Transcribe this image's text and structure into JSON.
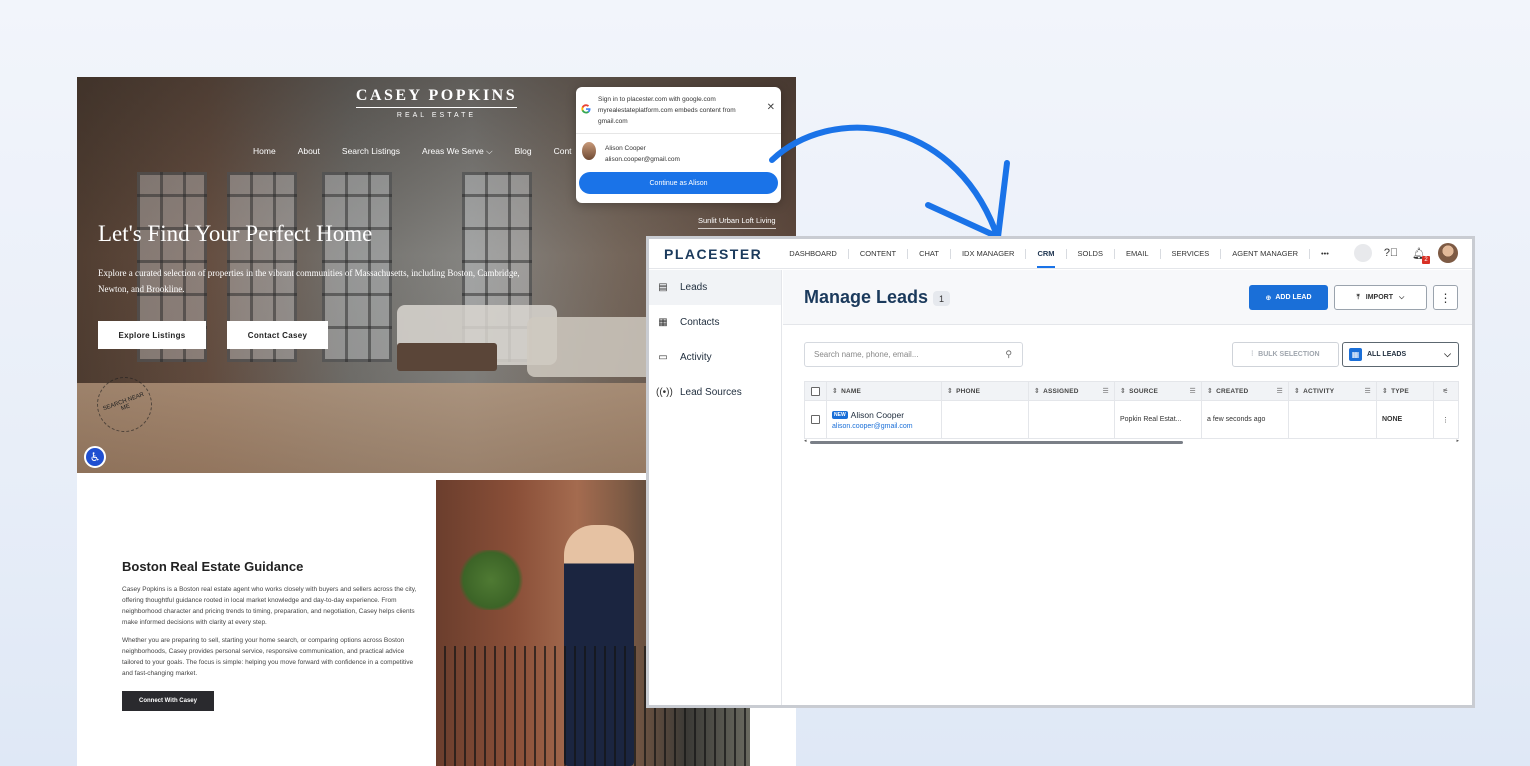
{
  "website": {
    "brand_name": "CASEY POPKINS",
    "brand_sub": "REAL ESTATE",
    "nav": [
      "Home",
      "About",
      "Search Listings",
      "Areas We Serve ⌵",
      "Blog",
      "Cont"
    ],
    "hero_title": "Let's Find Your Perfect Home",
    "hero_desc": "Explore a curated selection of properties in the vibrant communities of Massachusetts, including Boston, Cambridge, Newton, and Brookline.",
    "btn_explore": "Explore Listings",
    "btn_contact": "Contact Casey",
    "caption": "Sunlit Urban Loft Living",
    "stamp": "SEARCH NEAR ME",
    "about_title": "Boston Real Estate Guidance",
    "about_p1": "Casey Popkins is a Boston real estate agent who works closely with buyers and sellers across the city, offering thoughtful guidance rooted in local market knowledge and day-to-day experience. From neighborhood character and pricing trends to timing, preparation, and negotiation, Casey helps clients make informed decisions with clarity at every step.",
    "about_p2": "Whether you are preparing to sell, starting your home search, or comparing options across Boston neighborhoods, Casey provides personal service, responsive communication, and practical advice tailored to your goals. The focus is simple: helping you move forward with confidence in a competitive and fast-changing market.",
    "about_cta": "Connect With Casey"
  },
  "google_popup": {
    "line1": "Sign in to placester.com with google.com",
    "line2": "myrealestateplatform.com embeds content from gmail.com",
    "user_name": "Alison Cooper",
    "user_email": "alison.cooper@gmail.com",
    "continue_label": "Continue as Alison"
  },
  "crm": {
    "logo": "PLACESTER",
    "nav": [
      "DASHBOARD",
      "CONTENT",
      "CHAT",
      "IDX MANAGER",
      "CRM",
      "SOLDS",
      "EMAIL",
      "SERVICES",
      "AGENT MANAGER",
      "•••"
    ],
    "active_nav": "CRM",
    "notification_count": "2",
    "sidebar": [
      {
        "label": "Leads",
        "icon": "leads-icon"
      },
      {
        "label": "Contacts",
        "icon": "contacts-icon"
      },
      {
        "label": "Activity",
        "icon": "activity-icon"
      },
      {
        "label": "Lead Sources",
        "icon": "lead-sources-icon"
      }
    ],
    "page_title": "Manage Leads",
    "lead_count": "1",
    "add_lead": "ADD LEAD",
    "import": "IMPORT",
    "search_placeholder": "Search name, phone, email...",
    "bulk_selection": "BULK SELECTION",
    "filter_select": "ALL LEADS",
    "columns": [
      "NAME",
      "PHONE",
      "ASSIGNED",
      "SOURCE",
      "CREATED",
      "ACTIVITY",
      "TYPE"
    ],
    "rows": [
      {
        "badge": "NEW",
        "name": "Alison Cooper",
        "email": "alison.cooper@gmail.com",
        "phone": "",
        "assigned": "",
        "source": "Popkin Real Estat...",
        "created": "a few seconds ago",
        "activity": "",
        "type": "NONE"
      }
    ]
  },
  "colors": {
    "accent_blue": "#1a6fd8",
    "google_blue": "#1a73e8",
    "crm_title": "#1b3a5c",
    "arrow": "#1a73e8"
  }
}
